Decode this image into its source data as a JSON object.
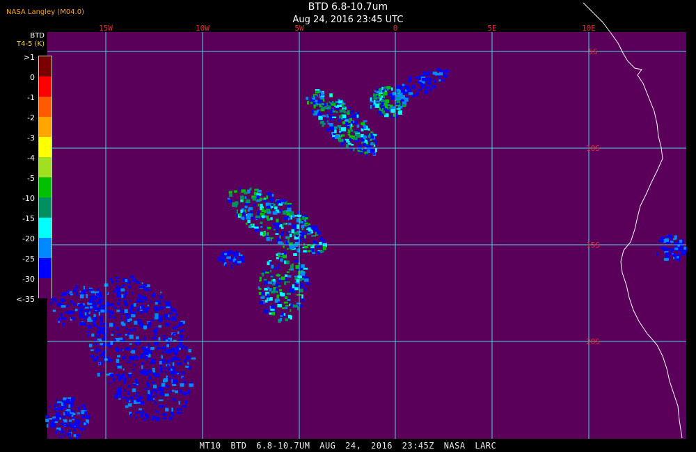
{
  "agency": "NASA Langley (M04.0)",
  "title": "BTD 6.8-10.7um",
  "datetime": "Aug 24, 2016 23:45 UTC",
  "legend": {
    "label": "BTD",
    "unit": "T4-5 (K)",
    "levels": [
      ">1",
      "0",
      "-1",
      "-2",
      "-3",
      "-4",
      "-5",
      "-10",
      "-15",
      "-20",
      "-25",
      "-30",
      "<-35"
    ],
    "colors": [
      "#7a0000",
      "#ff0000",
      "#ff5a00",
      "#ffa500",
      "#ffff00",
      "#a0e020",
      "#00c000",
      "#009060",
      "#00ffff",
      "#0088ff",
      "#0000ff",
      "#5a005a"
    ]
  },
  "map": {
    "background": "#5a005a",
    "grid_color": "#4cd8e6",
    "coast_color": "#ffffff",
    "lon_labels": [
      "15W",
      "10W",
      "5W",
      "0",
      "5E",
      "10E"
    ],
    "lat_labels": [
      "5S",
      "10S",
      "15S",
      "20S"
    ],
    "label_color": "#e0303a"
  },
  "footer": "MT10  BTD 6.8-10.7UM  AUG 24, 2016 23:45Z  NASA LARC"
}
